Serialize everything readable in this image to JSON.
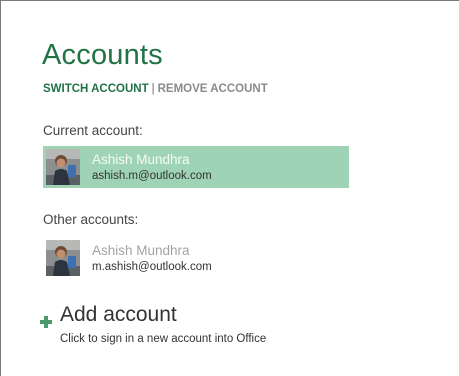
{
  "panel": {
    "title": "Accounts",
    "switch_account": "SWITCH ACCOUNT",
    "separator": "|",
    "remove_account": "REMOVE ACCOUNT",
    "accent_color": "#217346",
    "selected_color": "#9fd3b5"
  },
  "current": {
    "label": "Current account:",
    "account": {
      "name": "Ashish Mundhra",
      "email": "ashish.m@outlook.com",
      "avatar_icon": "user-photo"
    }
  },
  "other": {
    "label": "Other accounts:",
    "accounts": [
      {
        "name": "Ashish Mundhra",
        "email": "m.ashish@outlook.com",
        "avatar_icon": "user-photo"
      }
    ]
  },
  "add": {
    "title": "Add account",
    "subtitle": "Click to sign in a new account into Office",
    "icon": "plus-icon"
  }
}
